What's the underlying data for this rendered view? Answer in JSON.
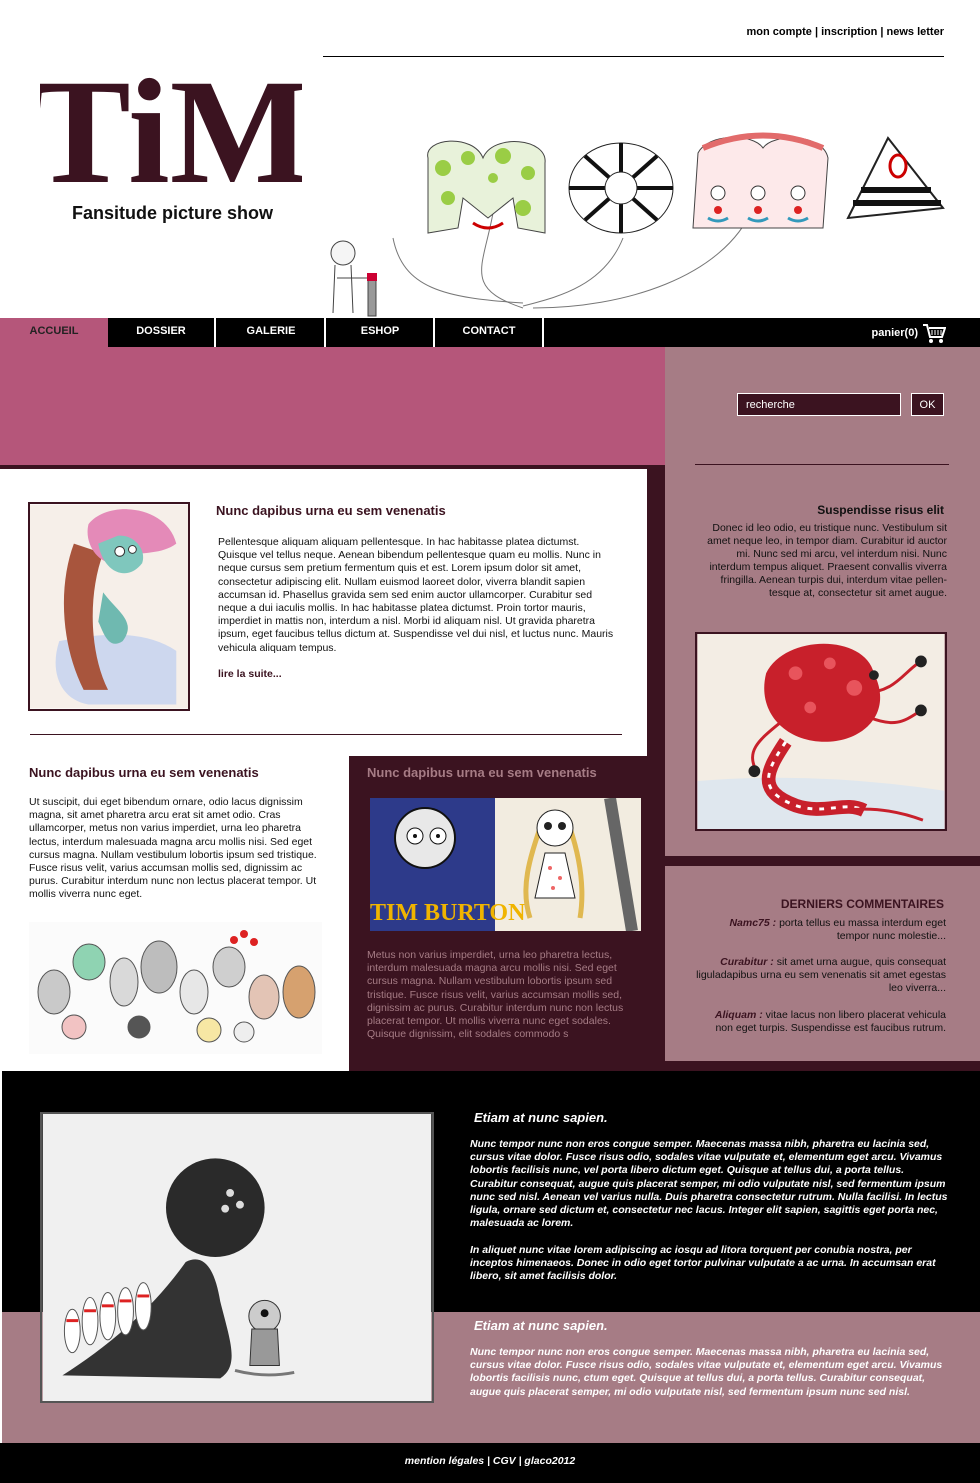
{
  "header": {
    "links": [
      "mon compte",
      "inscription",
      "news letter"
    ],
    "separator": " | ",
    "logo_text": "TiM",
    "tagline": "Fansitude picture show"
  },
  "nav": {
    "items": [
      "ACCUEIL",
      "DOSSIER",
      "GALERIE",
      "ESHOP",
      "CONTACT"
    ],
    "active": "ACCUEIL",
    "cart_label": "panier(0)"
  },
  "search": {
    "value": "recherche",
    "ok_label": "OK"
  },
  "sidebar": {
    "title": "Suspendisse risus elit",
    "text": "Donec id leo odio, eu tristique nunc. Vestibulum sit amet neque leo, in tempor diam. Curabitur id auctor mi. Nunc sed mi arcu, vel interdum nisi. Nunc interdum tempus aliquet. Praesent convallis viverra fringilla. Aenean turpis dui, interdum vitae pellen-tesque at, consectetur sit amet augue."
  },
  "comments": {
    "title": "DERNIERS COMMENTAIRES",
    "items": [
      {
        "author": "Namc75 :",
        "text": " porta tellus eu massa interdum eget tempor nunc molestie..."
      },
      {
        "author": "Curabitur :",
        "text": " sit amet urna augue, quis consequat liguladapibus urna eu sem venenatis sit amet egestas leo viverra..."
      },
      {
        "author": "Aliquam :",
        "text": "  vitae lacus non libero placerat vehicula non eget turpis. Suspendisse est faucibus rutrum."
      }
    ]
  },
  "article1": {
    "title": "Nunc dapibus urna eu sem venenatis",
    "text": "Pellentesque aliquam aliquam pellentesque. In hac habitasse platea dictumst. Quisque vel tellus neque. Aenean bibendum pellentesque quam eu mollis. Nunc in neque cursus sem pretium fermentum quis et est. Lorem ipsum dolor sit amet, consectetur adipiscing elit. Nullam euismod laoreet dolor, viverra blandit sapien accumsan id. Phasellus gravida sem sed enim auctor ullamcorper. Curabitur sed neque a dui iaculis mollis. In hac habitasse platea dictumst. Proin tortor mauris, imperdiet in mattis non, interdum a nisl. Morbi id aliquam nisl. Ut gravida pharetra ipsum, eget faucibus tellus dictum at. Suspendisse vel dui nisl, et luctus nunc. Mauris vehicula aliquam tempus.",
    "more": "lire la suite..."
  },
  "article2": {
    "title": "Nunc dapibus urna eu sem venenatis",
    "text": "Ut suscipit, dui eget bibendum ornare, odio lacus dignissim magna, sit amet pharetra arcu erat sit amet odio. Cras ullamcorper, metus non varius imperdiet, urna leo pharetra lectus, interdum malesuada magna arcu mollis nisi. Sed eget cursus magna. Nullam vestibulum lobortis ipsum sed tristique. Fusce risus velit, varius accumsan mollis sed, dignissim ac purus. Curabitur interdum nunc non lectus placerat tempor. Ut mollis viverra nunc eget."
  },
  "article3": {
    "title": "Nunc dapibus urna eu sem venenatis",
    "text": "Metus non varius imperdiet, urna leo pharetra lectus, interdum malesuada magna arcu mollis nisi. Sed eget cursus magna. Nullam vestibulum lobortis ipsum sed tristique. Fusce risus velit, varius accumsan mollis sed, dignissim ac purus. Curabitur interdum nunc non lectus placerat tempor. Ut mollis viverra nunc eget sodales. Quisque dignissim, elit sodales commodo s",
    "image_text": "TIM BURTON"
  },
  "feature": {
    "title1": "Etiam at nunc sapien.",
    "text1": "Nunc tempor nunc non eros congue semper. Maecenas massa nibh, pharetra eu lacinia sed, cursus vitae dolor. Fusce risus odio, sodales vitae vulputate et, elementum eget arcu. Vivamus lobortis facilisis nunc, vel porta libero dictum eget. Quisque at tellus dui, a porta tellus. Curabitur consequat, augue quis placerat semper, mi odio vulputate nisl, sed fermentum ipsum nunc sed nisl. Aenean vel varius nulla. Duis pharetra consectetur rutrum. Nulla facilisi. In lectus ligula, ornare sed dictum et, consectetur nec lacus. Integer elit sapien, sagittis eget porta nec, malesuada ac lorem.",
    "text2": "In aliquet nunc vitae lorem adipiscing ac iosqu ad litora torquent per conubia nostra, per inceptos himenaeos. Donec in odio eget tortor pulvinar vulputate a ac urna. In accumsan erat libero, sit amet facilisis dolor.",
    "title2": "Etiam at nunc sapien.",
    "text3": "Nunc tempor nunc non eros congue semper. Maecenas massa nibh, pharetra eu lacinia sed, cursus vitae dolor. Fusce risus odio, sodales vitae vulputate et, elementum eget arcu. Vivamus lobortis facilisis nunc, ctum eget. Quisque at tellus dui, a porta tellus. Curabitur consequat, augue quis placerat semper, mi odio vulputate nisl, sed fermentum ipsum nunc sed nisl."
  },
  "footer": {
    "text": "mention légales | CGV | glaco2012"
  },
  "colors": {
    "brand": "#3b1320",
    "pink": "#b5567a",
    "mauve": "#a67c85"
  }
}
